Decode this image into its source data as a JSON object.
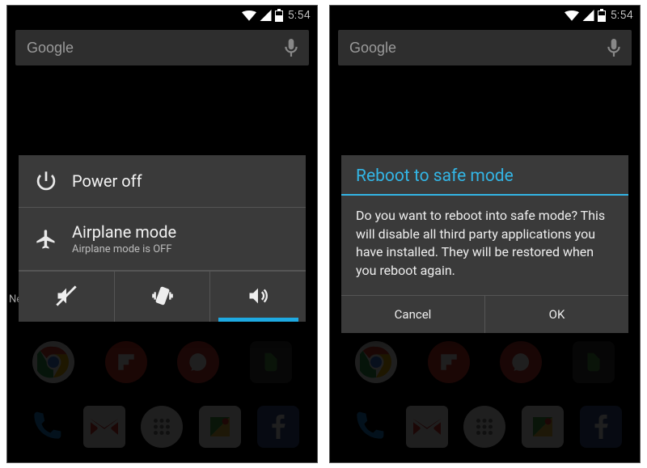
{
  "statusbar": {
    "clock": "5:54"
  },
  "search": {
    "label": "Google"
  },
  "left": {
    "news_fragment": "Ne",
    "power_off": "Power off",
    "airplane_title": "Airplane mode",
    "airplane_sub": "Airplane mode is OFF",
    "sound_options": [
      "silent",
      "vibrate",
      "sound"
    ],
    "sound_active_index": 2
  },
  "right": {
    "dialog_title": "Reboot to safe mode",
    "dialog_body": "Do you want to reboot into safe mode? This will disable all third party applications you have installed. They will be restored when you reboot again.",
    "cancel": "Cancel",
    "ok": "OK"
  },
  "app_icons": {
    "row1": [
      {
        "name": "chrome",
        "bg": "#fff"
      },
      {
        "name": "flipboard",
        "bg": "#e03a2f"
      },
      {
        "name": "authy",
        "bg": "#d63e34"
      },
      {
        "name": "evernote",
        "bg": "#5aa54e"
      }
    ],
    "row2": [
      {
        "name": "phone",
        "bg": "transparent"
      },
      {
        "name": "gmail",
        "bg": "#fff"
      },
      {
        "name": "apps",
        "bg": "#fff"
      },
      {
        "name": "maps",
        "bg": "#fff"
      },
      {
        "name": "facebook",
        "bg": "#3b5998"
      }
    ]
  }
}
